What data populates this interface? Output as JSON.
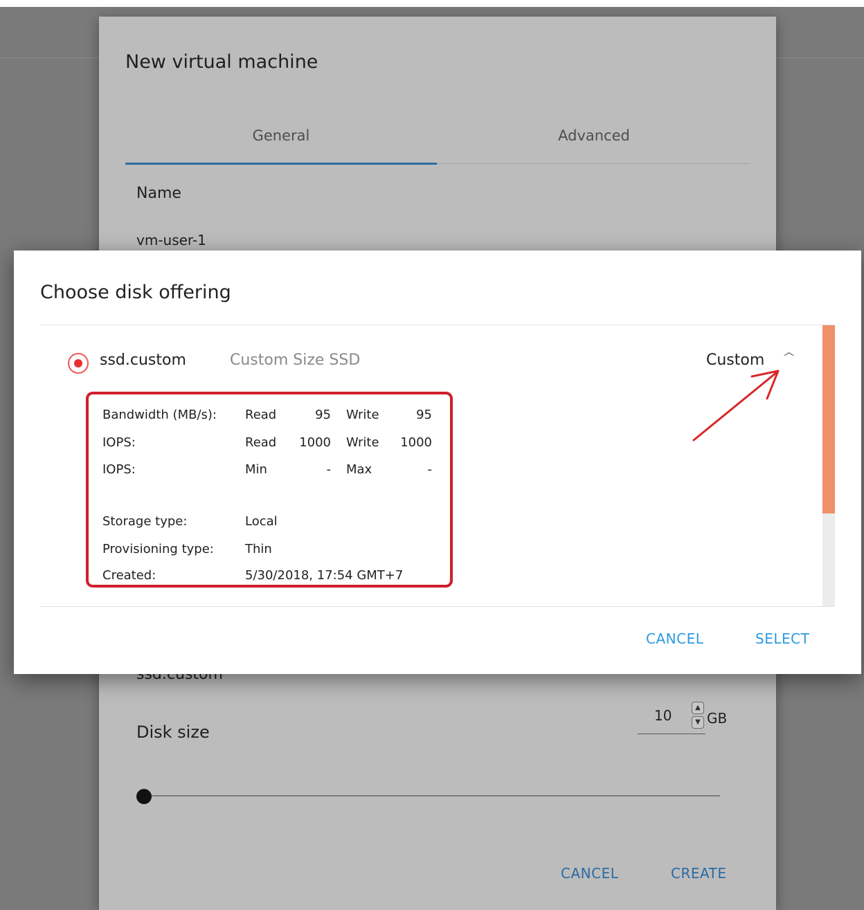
{
  "vm_dialog": {
    "title": "New virtual machine",
    "tabs": [
      {
        "label": "General",
        "active": true
      },
      {
        "label": "Advanced",
        "active": false
      }
    ],
    "name_label": "Name",
    "name_value": "vm-user-1",
    "selected_disk_offering": "ssd.custom",
    "disk_size_label": "Disk size",
    "disk_size_value": "10",
    "disk_size_unit": "GB",
    "cancel_label": "CANCEL",
    "create_label": "CREATE"
  },
  "disk_dialog": {
    "title": "Choose disk offering",
    "option": {
      "name": "ssd.custom",
      "description": "Custom Size SSD",
      "type": "Custom",
      "selected": true,
      "expanded": true,
      "details": {
        "bandwidth_label": "Bandwidth (MB/s):",
        "bandwidth_read_label": "Read",
        "bandwidth_read": "95",
        "bandwidth_write_label": "Write",
        "bandwidth_write": "95",
        "iops_label": "IOPS:",
        "iops_read_label": "Read",
        "iops_read": "1000",
        "iops_write_label": "Write",
        "iops_write": "1000",
        "iops2_label": "IOPS:",
        "iops_min_label": "Min",
        "iops_min": "-",
        "iops_max_label": "Max",
        "iops_max": "-",
        "storage_type_label": "Storage type:",
        "storage_type": "Local",
        "provisioning_type_label": "Provisioning type:",
        "provisioning_type": "Thin",
        "created_label": "Created:",
        "created": "5/30/2018, 17:54 GMT+7"
      }
    },
    "cancel_label": "CANCEL",
    "select_label": "SELECT"
  },
  "colors": {
    "radio_accent": "#e82f2f",
    "highlight_box": "#cf1f2b",
    "button_text": "#2d9ae1",
    "scrollbar_thumb": "#f0906a",
    "annotation_arrow": "#d62828"
  },
  "icons": {
    "expand": "chevron-up-icon",
    "annotation": "red-arrow-annotation"
  }
}
